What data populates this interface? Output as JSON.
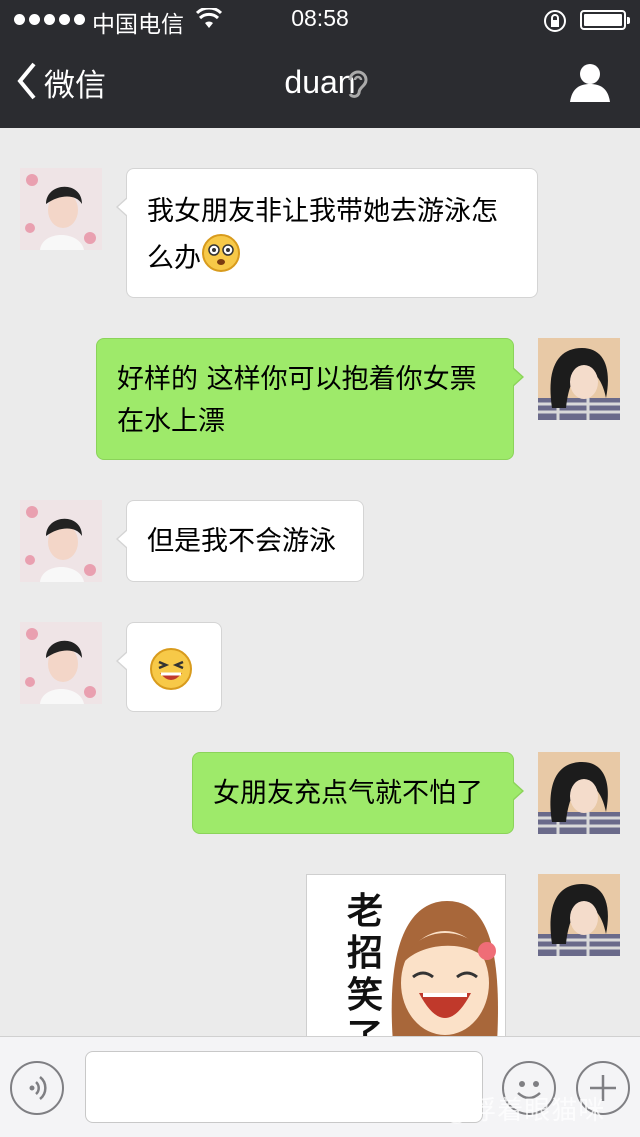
{
  "status_bar": {
    "carrier": "中国电信",
    "time": "08:58"
  },
  "nav": {
    "back_label": "微信",
    "title": "duan"
  },
  "messages": [
    {
      "side": "left",
      "text": "我女朋友非让我带她去游泳怎么办",
      "emoji": "dizzy-face"
    },
    {
      "side": "right",
      "text": "好样的 这样你可以抱着你女票在水上漂"
    },
    {
      "side": "left",
      "text": "但是我不会游泳"
    },
    {
      "side": "left",
      "text": "",
      "emoji": "laughing-face"
    },
    {
      "side": "right",
      "text": "女朋友充点气就不怕了"
    },
    {
      "side": "right",
      "sticker_text": "老招笑了"
    }
  ],
  "colors": {
    "sent_bubble": "#9eea6a",
    "received_bubble": "#ffffff",
    "chat_background": "#ebebeb",
    "nav_background": "#2b2c30"
  },
  "watermark": "百度 @浮着眼猫咪"
}
